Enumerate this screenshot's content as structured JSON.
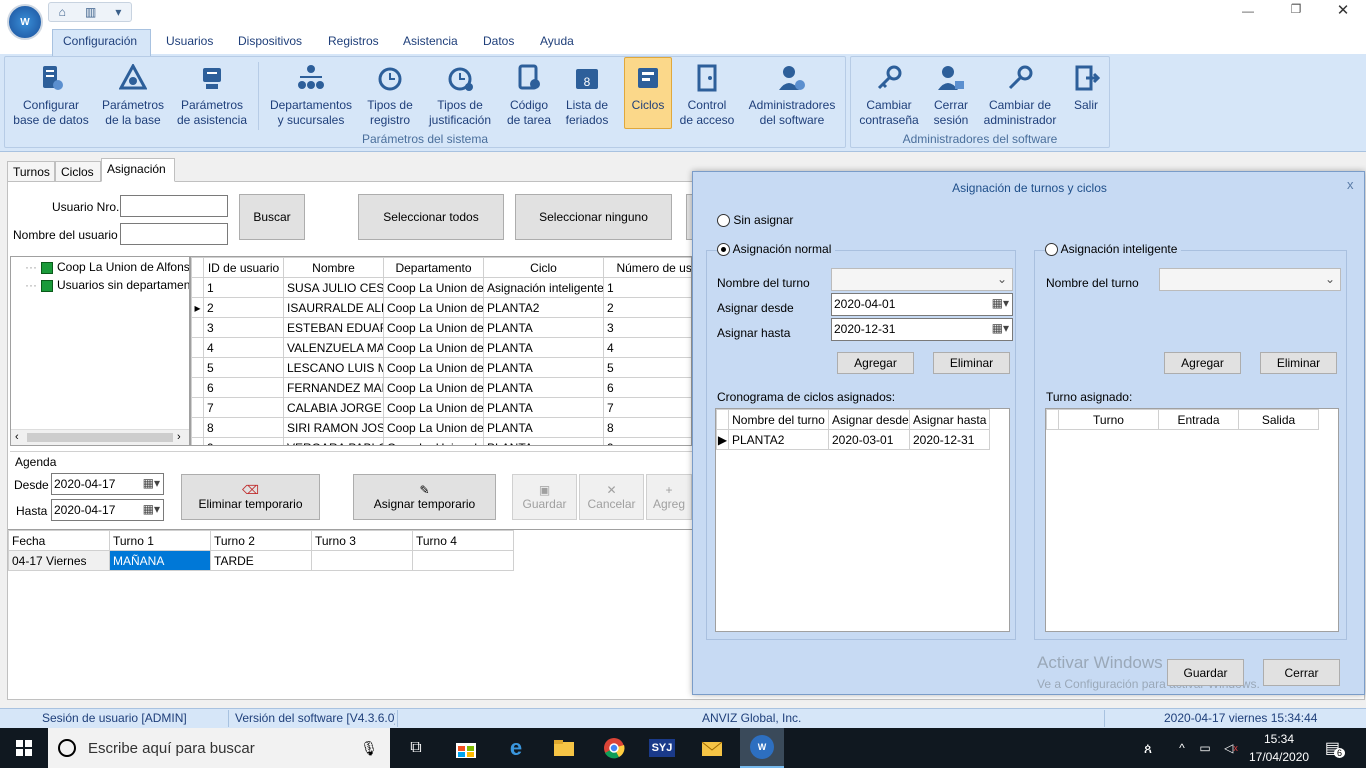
{
  "menu": [
    "Configuración",
    "Usuarios",
    "Dispositivos",
    "Registros",
    "Asistencia",
    "Datos",
    "Ayuda"
  ],
  "ribbon": {
    "group1_items": [
      {
        "label": "Configurar\nbase de datos",
        "icon": "database-config-icon"
      },
      {
        "label": "Parámetros\nde la base",
        "icon": "gear-triangle-icon"
      },
      {
        "label": "Parámetros\nde asistencia",
        "icon": "stamp-icon"
      }
    ],
    "group2_items": [
      {
        "label": "Departamentos\ny sucursales",
        "icon": "org-chart-icon"
      },
      {
        "label": "Tipos de\nregistro",
        "icon": "alarm-clock-icon"
      },
      {
        "label": "Tipos de\njustificación",
        "icon": "clock-alert-icon"
      },
      {
        "label": "Código\nde tarea",
        "icon": "task-code-icon"
      },
      {
        "label": "Lista de\nferiados",
        "icon": "calendar-icon"
      },
      {
        "label": "Ciclos",
        "icon": "cycles-icon"
      },
      {
        "label": "Control\nde acceso",
        "icon": "door-icon"
      },
      {
        "label": "Administradores\ndel software",
        "icon": "admin-gear-icon"
      }
    ],
    "group2_title": "Parámetros del sistema",
    "group3_items": [
      {
        "label": "Cambiar\ncontraseña",
        "icon": "key-icon"
      },
      {
        "label": "Cerrar\nsesión",
        "icon": "user-lock-icon"
      },
      {
        "label": "Cambiar de\nadministrador",
        "icon": "key-user-icon"
      },
      {
        "label": "Salir",
        "icon": "exit-icon"
      }
    ],
    "group3_title": "Administradores del software"
  },
  "tabs": [
    "Turnos",
    "Ciclos",
    "Asignación"
  ],
  "search": {
    "user_no_label": "Usuario Nro.",
    "user_name_label": "Nombre del usuario",
    "search_btn": "Buscar",
    "select_all_btn": "Seleccionar todos",
    "select_none_btn": "Seleccionar ninguno"
  },
  "tree": [
    "Coop La Union de Alfonso",
    "Usuarios sin departamento"
  ],
  "users_table": {
    "headers": [
      "ID de usuario",
      "Nombre",
      "Departamento",
      "Ciclo",
      "Número de usu"
    ],
    "rows": [
      [
        "1",
        "SUSA JULIO CESAR",
        "Coop La Union de",
        "Asignación inteligente",
        "1"
      ],
      [
        "2",
        "ISAURRALDE ALBE",
        "Coop La Union de",
        "PLANTA2",
        "2"
      ],
      [
        "3",
        "ESTEBAN EDUARD",
        "Coop La Union de",
        "PLANTA",
        "3"
      ],
      [
        "4",
        "VALENZUELA MAI",
        "Coop La Union de",
        "PLANTA",
        "4"
      ],
      [
        "5",
        "LESCANO LUIS M/",
        "Coop La Union de",
        "PLANTA",
        "5"
      ],
      [
        "6",
        "FERNANDEZ MAR",
        "Coop La Union de",
        "PLANTA",
        "6"
      ],
      [
        "7",
        "CALABIA JORGE N",
        "Coop La Union de",
        "PLANTA",
        "7"
      ],
      [
        "8",
        "SIRI RAMON JOSE",
        "Coop La Union de",
        "PLANTA",
        "8"
      ],
      [
        "9",
        "VERGARA PABLO",
        "Coop La Union de",
        "PLANTA",
        "9"
      ]
    ]
  },
  "agenda": {
    "title": "Agenda",
    "from_label": "Desde",
    "from_value": "2020-04-17",
    "to_label": "Hasta",
    "to_value": "2020-04-17",
    "delete_temp": "Eliminar temporario",
    "assign_temp": "Asignar temporario",
    "save": "Guardar",
    "cancel": "Cancelar",
    "add": "Agreg",
    "headers": [
      "Fecha",
      "Turno 1",
      "Turno 2",
      "Turno 3",
      "Turno 4"
    ],
    "rows": [
      [
        "04-17 Viernes",
        "MAÑANA",
        "TARDE",
        "",
        ""
      ]
    ]
  },
  "dialog": {
    "title": "Asignación de turnos y ciclos",
    "close": "x",
    "no_assign": "Sin asignar",
    "normal": "Asignación normal",
    "smart": "Asignación inteligente",
    "shift_name_label": "Nombre del turno",
    "assign_from_label": "Asignar desde",
    "assign_from_value": "2020-04-01",
    "assign_to_label": "Asignar hasta",
    "assign_to_value": "2020-12-31",
    "add": "Agregar",
    "delete": "Eliminar",
    "cycles_label": "Cronograma de ciclos asignados:",
    "cycles_headers": [
      "Nombre del turno",
      "Asignar desde",
      "Asignar hasta"
    ],
    "cycles_rows": [
      [
        "PLANTA2",
        "2020-03-01",
        "2020-12-31"
      ]
    ],
    "assigned_label": "Turno asignado:",
    "assigned_headers": [
      "Turno",
      "Entrada",
      "Salida"
    ],
    "save": "Guardar",
    "close_btn": "Cerrar",
    "watermark1": "Activar Windows",
    "watermark2": "Ve a Configuración para activar Windows."
  },
  "status": {
    "session": "Sesión de usuario  [ADMIN]",
    "version": "Versión del software  [V4.3.6.0]",
    "company": "ANVIZ Global, Inc.",
    "datetime": "2020-04-17 viernes 15:34:44"
  },
  "taskbar": {
    "search_placeholder": "Escribe aquí para buscar",
    "time": "15:34",
    "date": "17/04/2020",
    "notif": "6"
  },
  "colors": {
    "ribbon_bg": "#d6e6f8",
    "dialog_bg": "#c7daf3",
    "accent": "#1f5fb0",
    "highlight": "#0078d7",
    "taskbar": "#101820"
  }
}
